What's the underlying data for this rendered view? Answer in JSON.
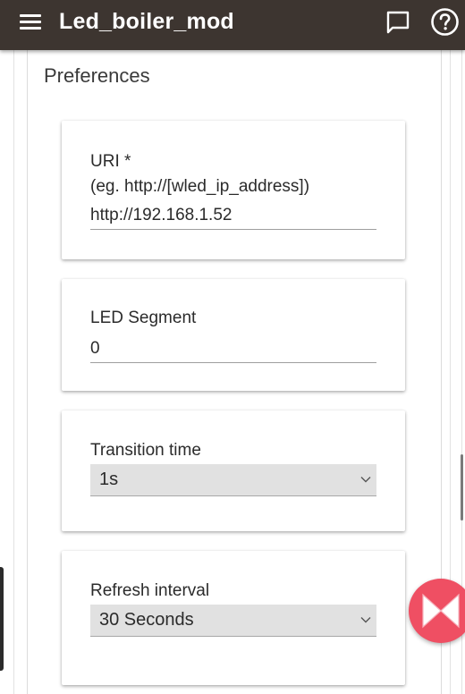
{
  "app_bar": {
    "title": "Led_boiler_mod",
    "icons": {
      "menu": "menu-icon",
      "chat": "chat-bubble-icon",
      "help": "help-circle-icon"
    }
  },
  "preferences": {
    "title": "Preferences",
    "uri": {
      "label": "URI *",
      "hint": "(eg. http://[wled_ip_address])",
      "value": "http://192.168.1.52"
    },
    "led_segment": {
      "label": "LED Segment",
      "value": "0"
    },
    "transition_time": {
      "label": "Transition time",
      "selected": "1s"
    },
    "refresh_interval": {
      "label": "Refresh interval",
      "selected": "30 Seconds"
    }
  },
  "colors": {
    "app_bar_bg": "#3d3530",
    "fab_bg": "#ef4f63",
    "select_bg": "#e1e1e1"
  }
}
